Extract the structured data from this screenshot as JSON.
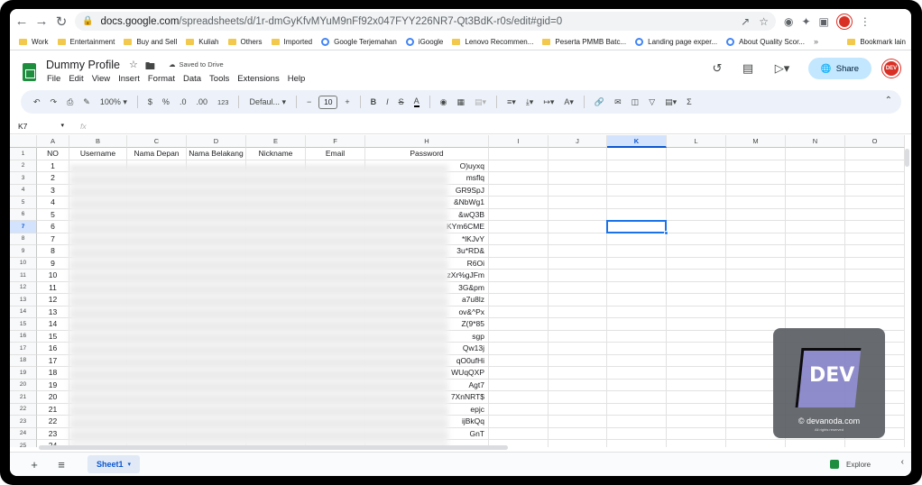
{
  "browser": {
    "url_host": "docs.google.com",
    "url_path": "/spreadsheets/d/1r-dmGyKfvMYuM9nFf92x047FYY226NR7-Qt3BdK-r0s/edit#gid=0",
    "bookmarks": [
      "Work",
      "Entertainment",
      "Buy and Sell",
      "Kuliah",
      "Others",
      "Imported",
      "Google Terjemahan",
      "iGoogle",
      "Lenovo Recommen...",
      "Peserta PMMB Batc...",
      "Landing page exper...",
      "About Quality Scor..."
    ],
    "bookmarks_more": "»",
    "bookmark_list": "Bookmark lain"
  },
  "doc": {
    "title": "Dummy Profile",
    "saved": "Saved to Drive",
    "menu": [
      "File",
      "Edit",
      "View",
      "Insert",
      "Format",
      "Data",
      "Tools",
      "Extensions",
      "Help"
    ],
    "share": "Share",
    "avatar": "DEV"
  },
  "toolbar": {
    "zoom": "100%",
    "currency": "$",
    "percent": "%",
    "dec_less": ".0",
    "dec_more": ".00",
    "number_fmt": "123",
    "font": "Defaul...",
    "font_size": "10",
    "bold": "B",
    "italic": "I",
    "strike": "S",
    "text_color": "A",
    "sum": "Σ"
  },
  "formula_bar": {
    "name_box": "K7",
    "fx": "fx"
  },
  "grid": {
    "columns": [
      "A",
      "B",
      "C",
      "D",
      "E",
      "F",
      "H",
      "I",
      "J",
      "K",
      "L",
      "M",
      "N",
      "O"
    ],
    "selected_column": "K",
    "selected_row": "7",
    "headers": [
      "NO",
      "Username",
      "Nama Depan",
      "Nama Belakang",
      "Nickname",
      "Email",
      "Password"
    ],
    "rows": [
      {
        "n": "1",
        "no": "1",
        "pw": "O)uyxq"
      },
      {
        "n": "2",
        "no": "2",
        "pw": "msflq"
      },
      {
        "n": "3",
        "no": "3",
        "pw": "GR9SpJ"
      },
      {
        "n": "4",
        "no": "4",
        "pw": "&NbWg1"
      },
      {
        "n": "5",
        "no": "5",
        "pw": "&wQ3B"
      },
      {
        "n": "6",
        "no": "6",
        "pw": "KYm6CME"
      },
      {
        "n": "7",
        "no": "7",
        "pw": "*lKJvY"
      },
      {
        "n": "8",
        "no": "8",
        "pw": "3u*RD&"
      },
      {
        "n": "9",
        "no": "9",
        "pw": "R6Oi"
      },
      {
        "n": "10",
        "no": "10",
        "pw": "zXr%gJFm"
      },
      {
        "n": "11",
        "no": "11",
        "pw": "3G&pm"
      },
      {
        "n": "12",
        "no": "12",
        "pw": "a7u8lz"
      },
      {
        "n": "13",
        "no": "13",
        "pw": "ov&^Px"
      },
      {
        "n": "14",
        "no": "14",
        "pw": "Z(9*85"
      },
      {
        "n": "15",
        "no": "15",
        "pw": "sgp"
      },
      {
        "n": "16",
        "no": "16",
        "pw": "Qw13j"
      },
      {
        "n": "17",
        "no": "17",
        "pw": "qO0ufHi"
      },
      {
        "n": "18",
        "no": "18",
        "pw": "WUqQXP"
      },
      {
        "n": "19",
        "no": "19",
        "pw": "Agt7"
      },
      {
        "n": "20",
        "no": "20",
        "pw": "7XnNRT$"
      },
      {
        "n": "21",
        "no": "21",
        "pw": "epjc"
      },
      {
        "n": "22",
        "no": "22",
        "pw": "ijBkQq"
      },
      {
        "n": "23",
        "no": "23",
        "pw": "GnT"
      },
      {
        "n": "24",
        "no": "24",
        "pw": ""
      }
    ]
  },
  "sheets": {
    "active": "Sheet1",
    "explore": "Explore"
  },
  "watermark": {
    "logo": "DEV",
    "copyright": "© devanoda.com",
    "rights": "All rights reserved"
  }
}
